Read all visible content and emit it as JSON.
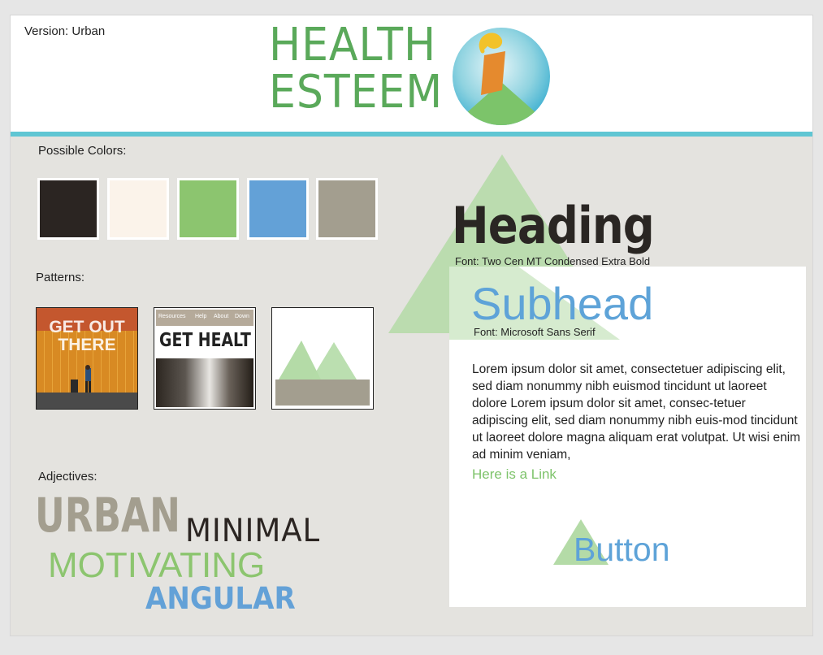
{
  "header": {
    "version": "Version: Urban",
    "logo_line1": "HEALTH",
    "logo_line2": "ESTEEM"
  },
  "colors": {
    "label": "Possible Colors:",
    "swatches": [
      "#2b2522",
      "#fbf3ea",
      "#8cc56f",
      "#63a1d7",
      "#a39e8f"
    ]
  },
  "patterns": {
    "label": "Patterns:",
    "p1_title": "GET OUT THERE",
    "p2_nav": [
      "Resources",
      "Help",
      "About",
      "Down"
    ],
    "p2_title": "GET HEALT"
  },
  "adjectives": {
    "label": "Adjectives:",
    "words": [
      "URBAN",
      "MINIMAL",
      "MOTIVATING",
      "ANGULAR"
    ]
  },
  "typography": {
    "heading": "Heading",
    "heading_font": "Font: Two Cen MT Condensed Extra Bold",
    "subhead": "Subhead",
    "subhead_font": "Font: Microsoft Sans Serif",
    "body": "Lorem ipsum dolor sit amet, consectetuer adipiscing elit, sed diam nonummy nibh euismod tincidunt ut laoreet dolore Lorem ipsum dolor sit amet, consec-tetuer adipiscing elit, sed diam nonummy nibh euis-mod tincidunt ut laoreet dolore magna aliquam erat volutpat. Ut wisi enim ad minim veniam,",
    "link": "Here is a Link",
    "button": "Button"
  },
  "palette": {
    "green": "#5aa95a",
    "teal": "#5fc6d3",
    "blue": "#5ea3d8",
    "light_green": "#b4dba7"
  }
}
